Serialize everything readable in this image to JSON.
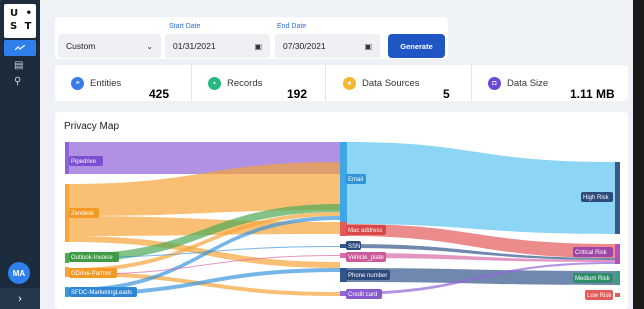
{
  "logo": {
    "line1": "U •",
    "line2": "S T"
  },
  "sidebar": {
    "avatar": "MA",
    "expand_icon": "chevron-right-icon"
  },
  "filter": {
    "range_value": "Custom",
    "start_label": "Start Date",
    "start_value": "01/31/2021",
    "end_label": "End Date",
    "end_value": "07/30/2021",
    "generate_label": "Generate"
  },
  "stats": [
    {
      "label": "Entities",
      "value": "425",
      "color": "#3b7be9",
      "icon": "entities-icon"
    },
    {
      "label": "Records",
      "value": "192",
      "color": "#27b883",
      "icon": "records-icon"
    },
    {
      "label": "Data Sources",
      "value": "5",
      "color": "#f5b82e",
      "icon": "data-sources-icon"
    },
    {
      "label": "Data Size",
      "value": "1.11 MB",
      "color": "#6a4ad6",
      "icon": "data-size-icon"
    }
  ],
  "privacy_map": {
    "title": "Privacy Map",
    "sources": [
      {
        "label": "Pipedrive",
        "color": "#8e63d9"
      },
      {
        "label": "Zendesk",
        "color": "#f7a43a"
      },
      {
        "label": "Outlook-Invoice",
        "color": "#4faa55"
      },
      {
        "label": "GDrive-Partner",
        "color": "#f7a43a"
      },
      {
        "label": "SFDC-MarketingLeads",
        "color": "#3b95dd"
      }
    ],
    "fields": [
      {
        "label": "Email",
        "color": "#3fa6e6"
      },
      {
        "label": "Mac address",
        "color": "#e35a5a"
      },
      {
        "label": "SSN",
        "color": "#34558b"
      },
      {
        "label": "Vehicle_plate",
        "color": "#d86aa8"
      },
      {
        "label": "Phone number",
        "color": "#34558b"
      },
      {
        "label": "Credit card",
        "color": "#9366d8"
      }
    ],
    "risks": [
      {
        "label": "High Risk",
        "color": "#3a5889"
      },
      {
        "label": "Critical Risk",
        "color": "#b052b7"
      },
      {
        "label": "Medium Risk",
        "color": "#3aa07a"
      },
      {
        "label": "Low Risk",
        "color": "#e35a5a"
      }
    ]
  }
}
